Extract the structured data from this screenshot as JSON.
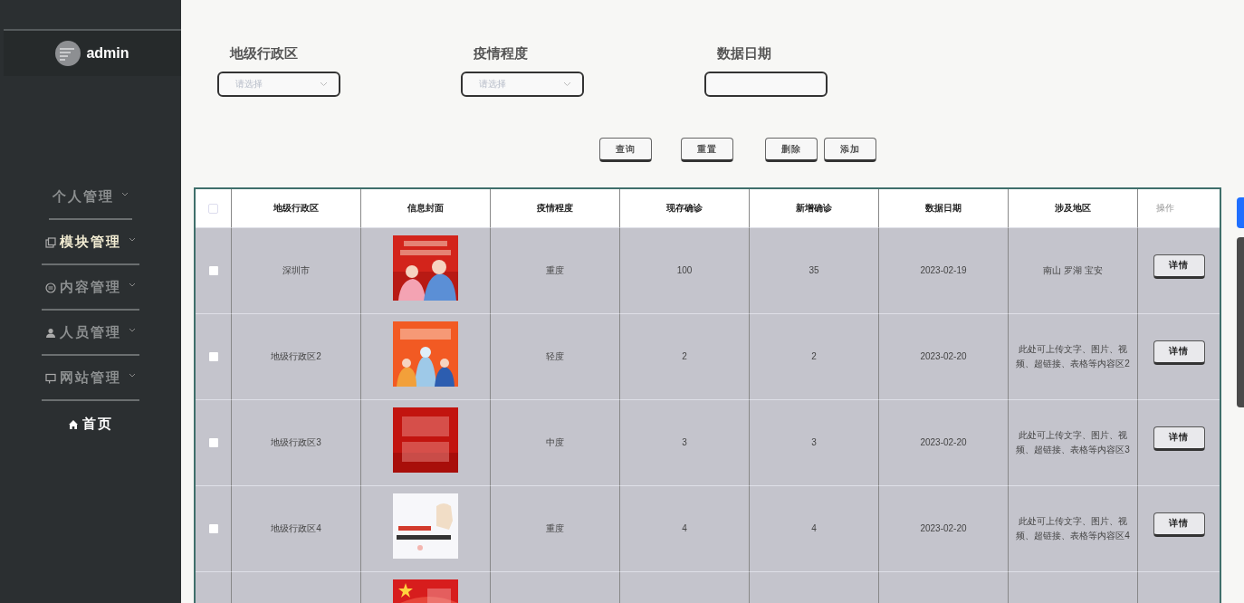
{
  "sidebar": {
    "user": "admin",
    "items": [
      {
        "label": "个人管理",
        "selected": false,
        "kind": "group"
      },
      {
        "label": "模块管理",
        "selected": true,
        "kind": "group"
      },
      {
        "label": "内容管理",
        "selected": false,
        "kind": "group"
      },
      {
        "label": "人员管理",
        "selected": false,
        "kind": "group"
      },
      {
        "label": "网站管理",
        "selected": false,
        "kind": "group"
      },
      {
        "label": "首页",
        "selected": false,
        "kind": "link"
      }
    ]
  },
  "filters": [
    {
      "label": "地级行政区",
      "kind": "select",
      "placeholder": "请选择"
    },
    {
      "label": "疫情程度",
      "kind": "select",
      "placeholder": "请选择"
    },
    {
      "label": "数据日期",
      "kind": "input"
    }
  ],
  "actions": [
    "查询",
    "重置",
    "删除",
    "添加"
  ],
  "table": {
    "all_checked": false,
    "columns": [
      "地级行政区",
      "信息封面",
      "疫情程度",
      "现存确诊",
      "新增确诊",
      "数据日期",
      "涉及地区",
      "操作"
    ],
    "rows": [
      {
        "checked": false,
        "cells": [
          "深圳市",
          {
            "kind": "picture"
          },
          "重度",
          "100",
          "35",
          "2023-02-19",
          "南山 罗湖 宝安"
        ],
        "action": "详情"
      },
      {
        "checked": false,
        "cells": [
          "地级行政区2",
          {
            "kind": "picture"
          },
          "轻度",
          "2",
          "2",
          "2023-02-20",
          "此处可上传文字、图片、视频、超链接、表格等内容区2"
        ],
        "action": "详情"
      },
      {
        "checked": false,
        "cells": [
          "地级行政区3",
          {
            "kind": "picture"
          },
          "中度",
          "3",
          "3",
          "2023-02-20",
          "此处可上传文字、图片、视频、超链接、表格等内容区3"
        ],
        "action": "详情"
      },
      {
        "checked": false,
        "cells": [
          "地级行政区4",
          {
            "kind": "picture"
          },
          "重度",
          "4",
          "4",
          "2023-02-20",
          "此处可上传文字、图片、视频、超链接、表格等内容区4"
        ],
        "action": "详情"
      },
      {
        "cells": [
          "",
          {
            "kind": "picture"
          },
          "",
          "",
          "",
          "",
          ""
        ]
      }
    ]
  }
}
